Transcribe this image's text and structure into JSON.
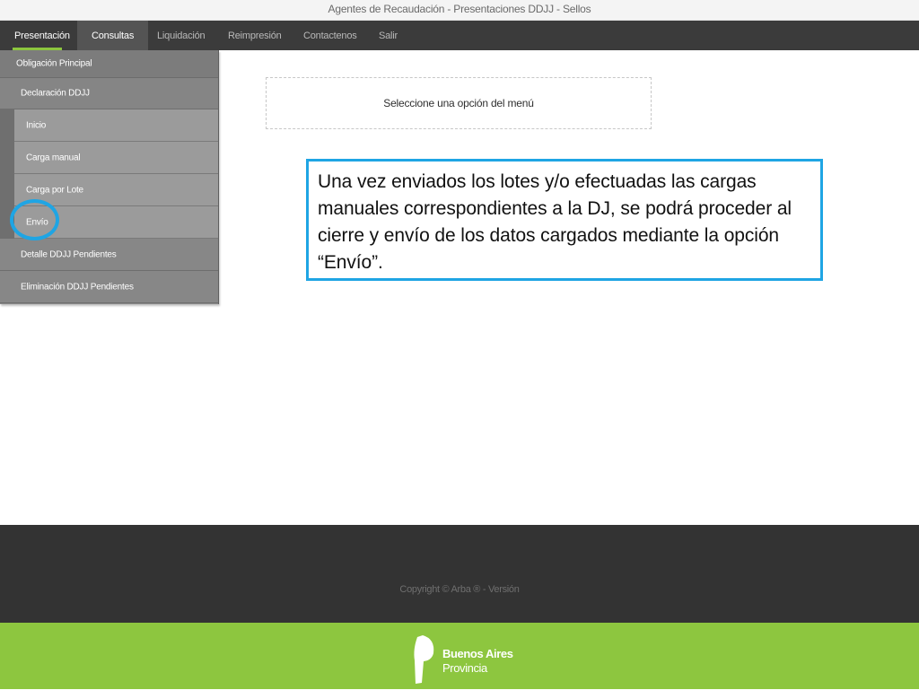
{
  "window": {
    "title": "Agentes de Recaudación - Presentaciones DDJJ - Sellos"
  },
  "nav": {
    "items": [
      "Presentación",
      "Consultas",
      "Liquidación",
      "Reimpresión",
      "Contactenos",
      "Salir"
    ]
  },
  "menu": {
    "header": "Obligación Principal",
    "section": "Declaración DDJJ",
    "subitems": [
      "Inicio",
      "Carga manual",
      "Carga por Lote",
      "Envío"
    ],
    "items": [
      "Detalle DDJJ Pendientes",
      "Eliminación DDJJ Pendientes"
    ]
  },
  "main": {
    "prompt": "Seleccione una opción del menú"
  },
  "callout": {
    "text": "Una vez enviados los lotes y/o efectuadas las cargas manuales correspondientes a la DJ, se podrá proceder al cierre y envío de los datos cargados mediante la opción “Envío”."
  },
  "footer": {
    "copyright": "Copyright © Arba ® - Versión",
    "logo_line1": "Buenos Aires",
    "logo_line2": "Provincia"
  },
  "colors": {
    "accent_green": "#8dc63f",
    "highlight_blue": "#1fa5e4",
    "nav_bg": "#3b3b3b"
  },
  "icons": {
    "logo": "buenos-aires-provincia-logo"
  }
}
